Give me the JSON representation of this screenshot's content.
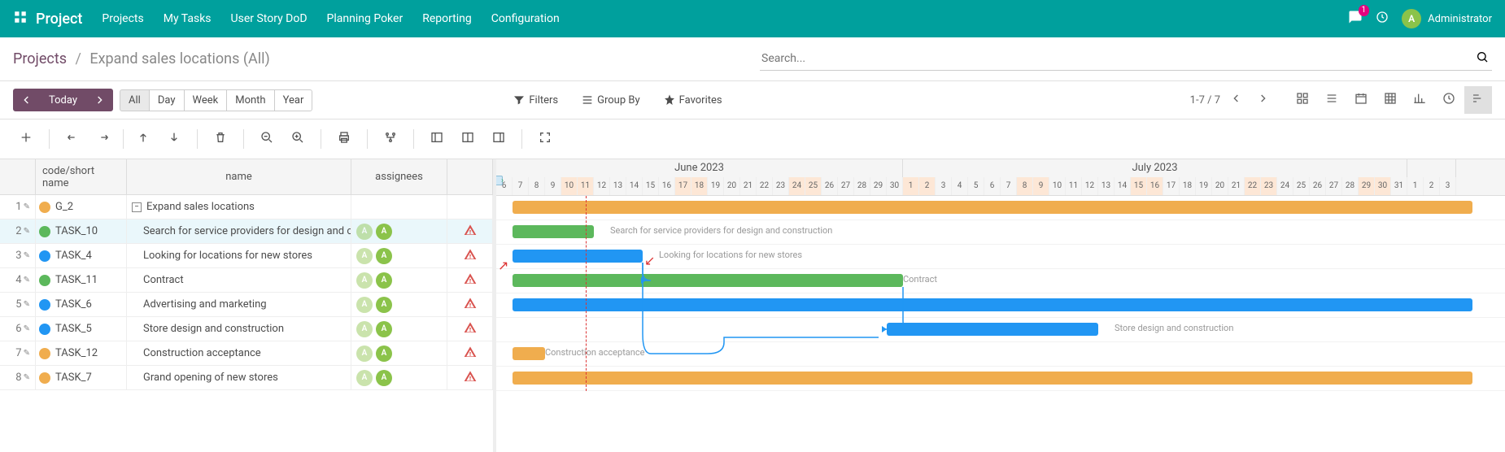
{
  "navbar": {
    "app_title": "Project",
    "links": [
      "Projects",
      "My Tasks",
      "User Story DoD",
      "Planning Poker",
      "Reporting",
      "Configuration"
    ],
    "msg_count": "1",
    "user_name": "Administrator",
    "user_initial": "A"
  },
  "breadcrumb": {
    "root": "Projects",
    "current": "Expand sales locations",
    "tag": "(All)"
  },
  "search": {
    "placeholder": "Search..."
  },
  "filters": {
    "filters_label": "Filters",
    "groupby_label": "Group By",
    "favorites_label": "Favorites",
    "today": "Today",
    "ranges": [
      "All",
      "Day",
      "Week",
      "Month",
      "Year"
    ],
    "active_range": "All",
    "pager": "1-7 / 7"
  },
  "columns": {
    "code": "code/short name",
    "name": "name",
    "assignees": "assignees"
  },
  "months": [
    {
      "label": "June 2023",
      "days": 25
    },
    {
      "label": "July 2023",
      "days": 31
    },
    {
      "label": "",
      "days": 3
    }
  ],
  "day_start_june": 6,
  "rows": [
    {
      "idx": 1,
      "color": "#f0ad4e",
      "code": "G_2",
      "name": "Expand sales locations",
      "indent": 0,
      "assignees": [],
      "warn": false,
      "collapsible": true,
      "bar": {
        "start": 1,
        "span": 59,
        "color": "orange"
      }
    },
    {
      "idx": 2,
      "color": "#5cb85c",
      "code": "TASK_10",
      "name": "Search for service providers for design and construction",
      "indent": 1,
      "assignees": [
        "A",
        "A"
      ],
      "faded_first": true,
      "warn": true,
      "bar": {
        "start": 1,
        "span": 5,
        "color": "green"
      },
      "label": "Search for service providers for design and construction",
      "label_offset": 7,
      "hovered": true
    },
    {
      "idx": 3,
      "color": "#2196f3",
      "code": "TASK_4",
      "name": "Looking for locations for new stores",
      "indent": 1,
      "assignees": [
        "A",
        "A"
      ],
      "faded_first": true,
      "warn": true,
      "bar": {
        "start": 1,
        "span": 8,
        "color": "blue"
      },
      "label": "Looking for locations for new stores",
      "label_offset": 10
    },
    {
      "idx": 4,
      "color": "#5cb85c",
      "code": "TASK_11",
      "name": "Contract",
      "indent": 1,
      "assignees": [
        "A",
        "A"
      ],
      "faded_first": true,
      "warn": true,
      "bar": {
        "start": 1,
        "span": 24,
        "color": "green"
      },
      "label": "Contract",
      "label_offset": 25
    },
    {
      "idx": 5,
      "color": "#2196f3",
      "code": "TASK_6",
      "name": "Advertising and marketing",
      "indent": 1,
      "assignees": [
        "A",
        "A"
      ],
      "faded_first": true,
      "warn": true,
      "bar": {
        "start": 1,
        "span": 59,
        "color": "blue"
      }
    },
    {
      "idx": 6,
      "color": "#2196f3",
      "code": "TASK_5",
      "name": "Store design and construction",
      "indent": 1,
      "assignees": [
        "A",
        "A"
      ],
      "faded_first": true,
      "warn": true,
      "bar": {
        "start": 24,
        "span": 13,
        "color": "blue"
      },
      "label": "Store design and construction",
      "label_offset": 38
    },
    {
      "idx": 7,
      "color": "#f0ad4e",
      "code": "TASK_12",
      "name": "Construction acceptance",
      "indent": 1,
      "assignees": [
        "A",
        "A"
      ],
      "faded_first": true,
      "warn": true,
      "bar": {
        "start": 1,
        "span": 2,
        "color": "orange"
      },
      "label": "Construction acceptance",
      "label_offset": 3
    },
    {
      "idx": 8,
      "color": "#f0ad4e",
      "code": "TASK_7",
      "name": "Grand opening of new stores",
      "indent": 1,
      "assignees": [
        "A",
        "A"
      ],
      "faded_first": true,
      "warn": true,
      "bar": {
        "start": 1,
        "span": 59,
        "color": "orange"
      }
    }
  ],
  "today_day_index": 5.5,
  "weekends_june": [
    10,
    11,
    17,
    18,
    24,
    25
  ],
  "weekends_july": [
    1,
    2,
    8,
    9,
    15,
    16,
    22,
    23,
    29,
    30
  ]
}
